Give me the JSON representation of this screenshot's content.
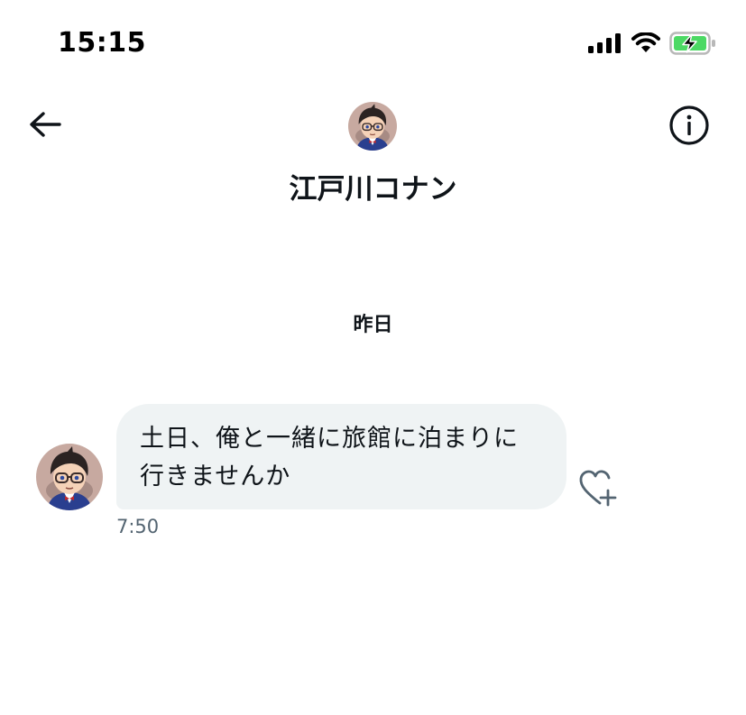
{
  "status_bar": {
    "time": "15:15",
    "icons": [
      "cellular-signal-icon",
      "wifi-icon",
      "battery-charging-icon"
    ],
    "battery_color": "#4cd964"
  },
  "header": {
    "back_icon": "arrow-left-icon",
    "info_icon": "info-circle-icon",
    "contact_name": "江戸川コナン"
  },
  "conversation": {
    "day_separator": "昨日",
    "messages": [
      {
        "sender": "江戸川コナン",
        "lines": [
          "土日、俺と一緒に旅館に泊まりに",
          "行きませんか"
        ],
        "time": "7:50",
        "reaction_icon": "heart-plus-icon"
      }
    ]
  },
  "colors": {
    "bubble_bg": "#eff3f4",
    "text_primary": "#0f1419",
    "text_secondary": "#536471"
  }
}
